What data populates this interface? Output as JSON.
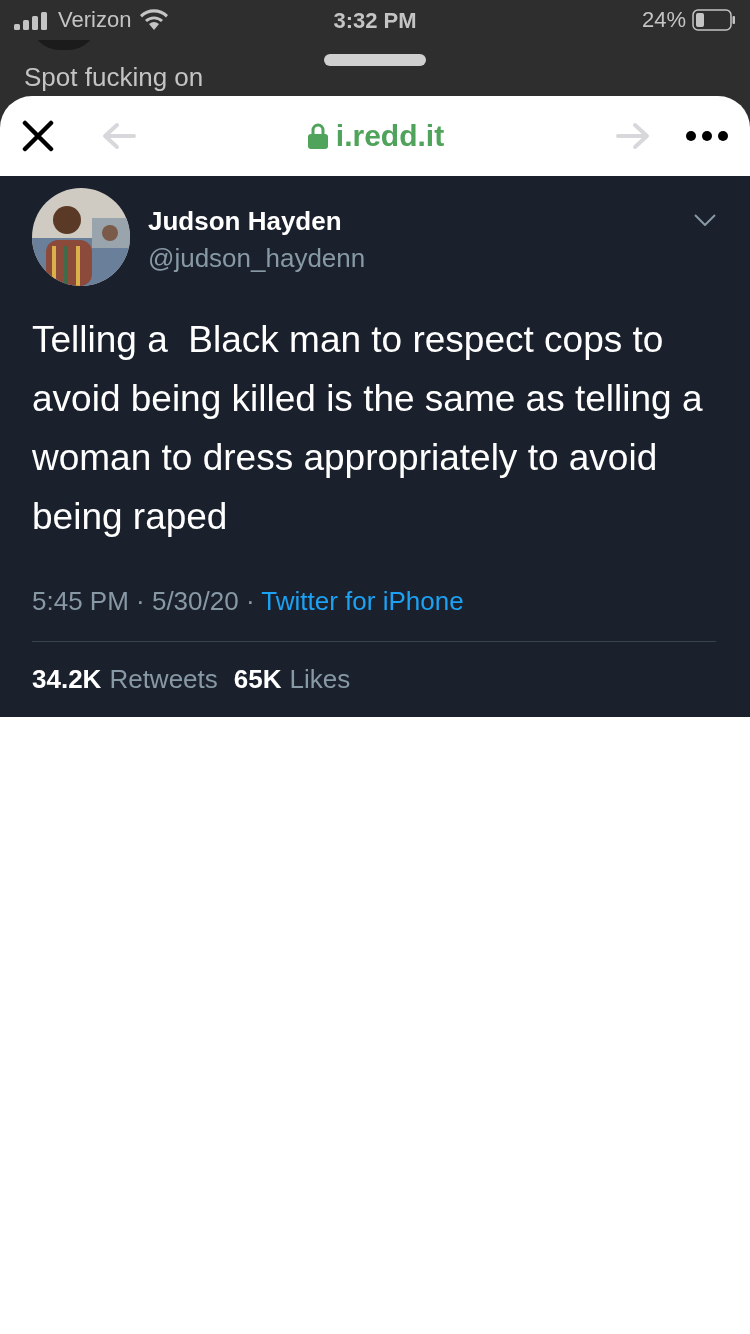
{
  "status_bar": {
    "carrier": "Verizon",
    "time": "3:32 PM",
    "battery": "24%"
  },
  "background_comment": {
    "text": "Spot fucking on"
  },
  "browser": {
    "url": "i.redd.it",
    "back_disabled": true,
    "forward_disabled": true
  },
  "tweet": {
    "name": "Judson Hayden",
    "handle": "@judson_haydenn",
    "text": "Telling a  Black man to respect cops to avoid being killed is the same as telling a woman to dress appropriately to avoid being raped",
    "time": "5:45 PM · 5/30/20 · ",
    "source": "Twitter for iPhone",
    "stats": [
      {
        "count": "34.2K",
        "label": "Retweets"
      },
      {
        "count": "65K",
        "label": "Likes"
      }
    ]
  }
}
